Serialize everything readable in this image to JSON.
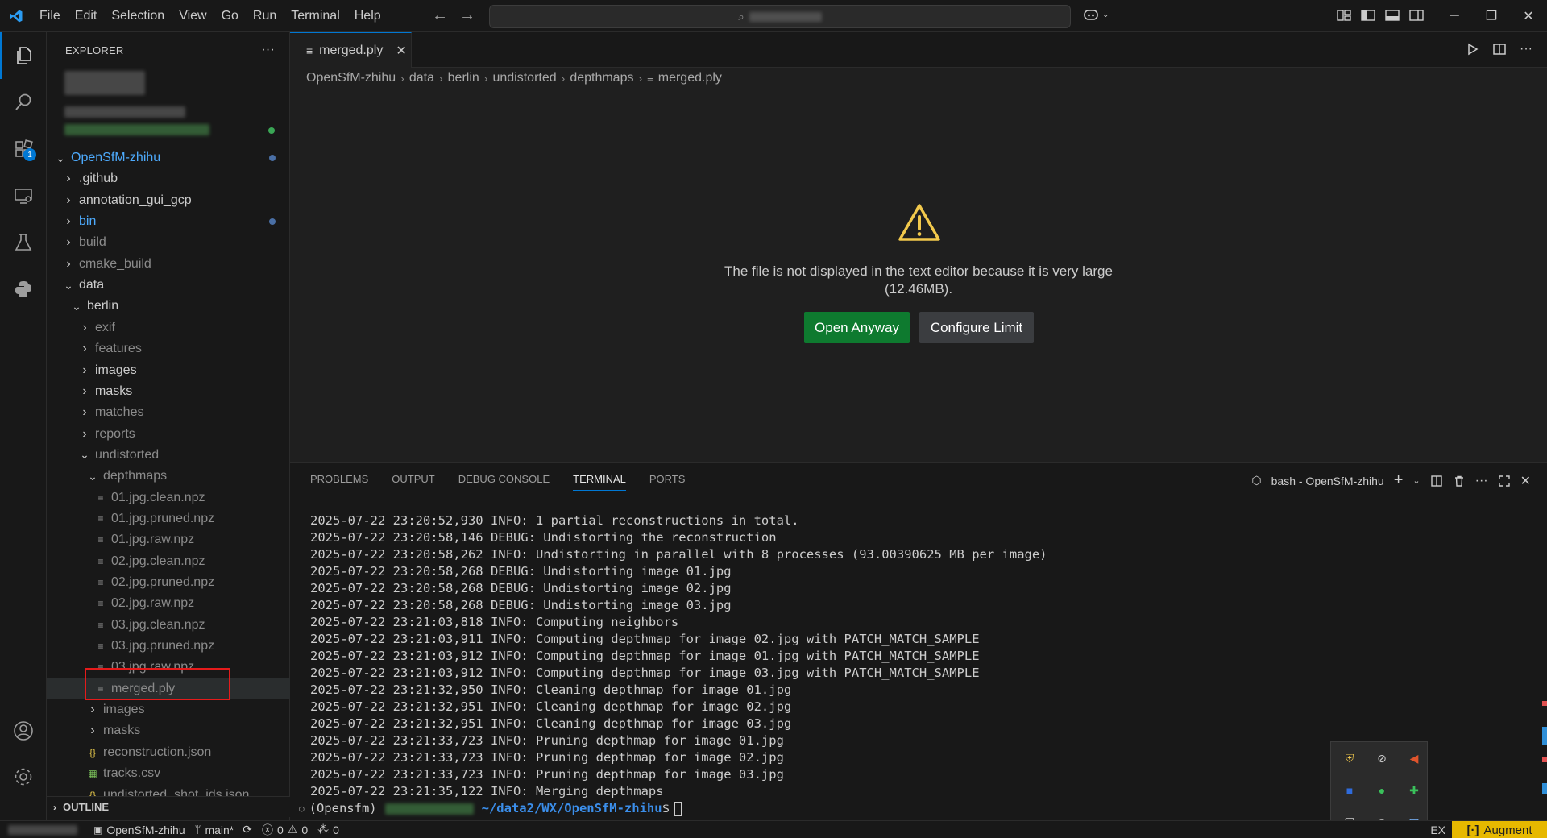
{
  "menu": [
    "File",
    "Edit",
    "Selection",
    "View",
    "Go",
    "Run",
    "Terminal",
    "Help"
  ],
  "explorer": {
    "header": "EXPLORER",
    "more": "···",
    "tree": [
      {
        "label": "OpenSfM-zhihu",
        "kind": "folder-open",
        "depth": 0,
        "color": "blue",
        "dot": "#4a6fa5"
      },
      {
        "label": ".github",
        "kind": "folder",
        "depth": 1,
        "color": "normal"
      },
      {
        "label": "annotation_gui_gcp",
        "kind": "folder",
        "depth": 1,
        "color": "normal"
      },
      {
        "label": "bin",
        "kind": "folder",
        "depth": 1,
        "color": "blue",
        "dot": "#4a6fa5"
      },
      {
        "label": "build",
        "kind": "folder",
        "depth": 1,
        "color": "dim"
      },
      {
        "label": "cmake_build",
        "kind": "folder",
        "depth": 1,
        "color": "dim"
      },
      {
        "label": "data",
        "kind": "folder-open",
        "depth": 1,
        "color": "normal"
      },
      {
        "label": "berlin",
        "kind": "folder-open",
        "depth": 2,
        "color": "normal"
      },
      {
        "label": "exif",
        "kind": "folder",
        "depth": 3,
        "color": "dim"
      },
      {
        "label": "features",
        "kind": "folder",
        "depth": 3,
        "color": "dim"
      },
      {
        "label": "images",
        "kind": "folder",
        "depth": 3,
        "color": "normal"
      },
      {
        "label": "masks",
        "kind": "folder",
        "depth": 3,
        "color": "normal"
      },
      {
        "label": "matches",
        "kind": "folder",
        "depth": 3,
        "color": "dim"
      },
      {
        "label": "reports",
        "kind": "folder",
        "depth": 3,
        "color": "dim"
      },
      {
        "label": "undistorted",
        "kind": "folder-open",
        "depth": 3,
        "color": "dim"
      },
      {
        "label": "depthmaps",
        "kind": "folder-open",
        "depth": 4,
        "color": "dim"
      },
      {
        "label": "01.jpg.clean.npz",
        "kind": "file",
        "depth": 5,
        "color": "dim"
      },
      {
        "label": "01.jpg.pruned.npz",
        "kind": "file",
        "depth": 5,
        "color": "dim"
      },
      {
        "label": "01.jpg.raw.npz",
        "kind": "file",
        "depth": 5,
        "color": "dim"
      },
      {
        "label": "02.jpg.clean.npz",
        "kind": "file",
        "depth": 5,
        "color": "dim"
      },
      {
        "label": "02.jpg.pruned.npz",
        "kind": "file",
        "depth": 5,
        "color": "dim"
      },
      {
        "label": "02.jpg.raw.npz",
        "kind": "file",
        "depth": 5,
        "color": "dim"
      },
      {
        "label": "03.jpg.clean.npz",
        "kind": "file",
        "depth": 5,
        "color": "dim"
      },
      {
        "label": "03.jpg.pruned.npz",
        "kind": "file",
        "depth": 5,
        "color": "dim"
      },
      {
        "label": "03.jpg.raw.npz",
        "kind": "file",
        "depth": 5,
        "color": "dim"
      },
      {
        "label": "merged.ply",
        "kind": "file",
        "depth": 5,
        "color": "dim",
        "selected": true
      },
      {
        "label": "images",
        "kind": "folder",
        "depth": 4,
        "color": "dim"
      },
      {
        "label": "masks",
        "kind": "folder",
        "depth": 4,
        "color": "dim"
      },
      {
        "label": "reconstruction.json",
        "kind": "json",
        "depth": 4,
        "color": "dim"
      },
      {
        "label": "tracks.csv",
        "kind": "csv",
        "depth": 4,
        "color": "dim"
      },
      {
        "label": "undistorted_shot_ids.json",
        "kind": "json",
        "depth": 4,
        "color": "dim"
      }
    ],
    "outline": "OUTLINE"
  },
  "editor": {
    "tab_label": "merged.ply",
    "breadcrumb": [
      "OpenSfM-zhihu",
      "data",
      "berlin",
      "undistorted",
      "depthmaps",
      "merged.ply"
    ],
    "message_line1": "The file is not displayed in the text editor because it is very large",
    "message_line2": "(12.46MB).",
    "open_anyway": "Open Anyway",
    "configure_limit": "Configure Limit"
  },
  "panel": {
    "tabs": [
      "PROBLEMS",
      "OUTPUT",
      "DEBUG CONSOLE",
      "TERMINAL",
      "PORTS"
    ],
    "active_tab": "TERMINAL",
    "terminal_name": "bash - OpenSfM-zhihu",
    "lines": [
      "2025-07-22 23:20:52,930 INFO: 1 partial reconstructions in total.",
      "2025-07-22 23:20:58,146 DEBUG: Undistorting the reconstruction",
      "2025-07-22 23:20:58,262 INFO: Undistorting in parallel with 8 processes (93.00390625 MB per image)",
      "2025-07-22 23:20:58,268 DEBUG: Undistorting image 01.jpg",
      "2025-07-22 23:20:58,268 DEBUG: Undistorting image 02.jpg",
      "2025-07-22 23:20:58,268 DEBUG: Undistorting image 03.jpg",
      "2025-07-22 23:21:03,818 INFO: Computing neighbors",
      "2025-07-22 23:21:03,911 INFO: Computing depthmap for image 02.jpg with PATCH_MATCH_SAMPLE",
      "2025-07-22 23:21:03,912 INFO: Computing depthmap for image 01.jpg with PATCH_MATCH_SAMPLE",
      "2025-07-22 23:21:03,912 INFO: Computing depthmap for image 03.jpg with PATCH_MATCH_SAMPLE",
      "2025-07-22 23:21:32,950 INFO: Cleaning depthmap for image 01.jpg",
      "2025-07-22 23:21:32,951 INFO: Cleaning depthmap for image 02.jpg",
      "2025-07-22 23:21:32,951 INFO: Cleaning depthmap for image 03.jpg",
      "2025-07-22 23:21:33,723 INFO: Pruning depthmap for image 01.jpg",
      "2025-07-22 23:21:33,723 INFO: Pruning depthmap for image 02.jpg",
      "2025-07-22 23:21:33,723 INFO: Pruning depthmap for image 03.jpg",
      "2025-07-22 23:21:35,122 INFO: Merging depthmaps"
    ],
    "prompt_env": "(Opensfm)",
    "prompt_path": "~/data2/WX/OpenSfM-zhihu",
    "prompt_symbol": "$"
  },
  "status": {
    "repo": "OpenSfM-zhihu",
    "branch": "main*",
    "errors": "0",
    "warnings": "0",
    "ports": "0",
    "ex": "EX",
    "augment": "Augment"
  },
  "colors": {
    "accent": "#0078d4",
    "primary_button": "#0e7a2f",
    "augment": "#e6b800",
    "highlight_box": "#e51b1b",
    "warning_icon": "#f2c94c"
  }
}
